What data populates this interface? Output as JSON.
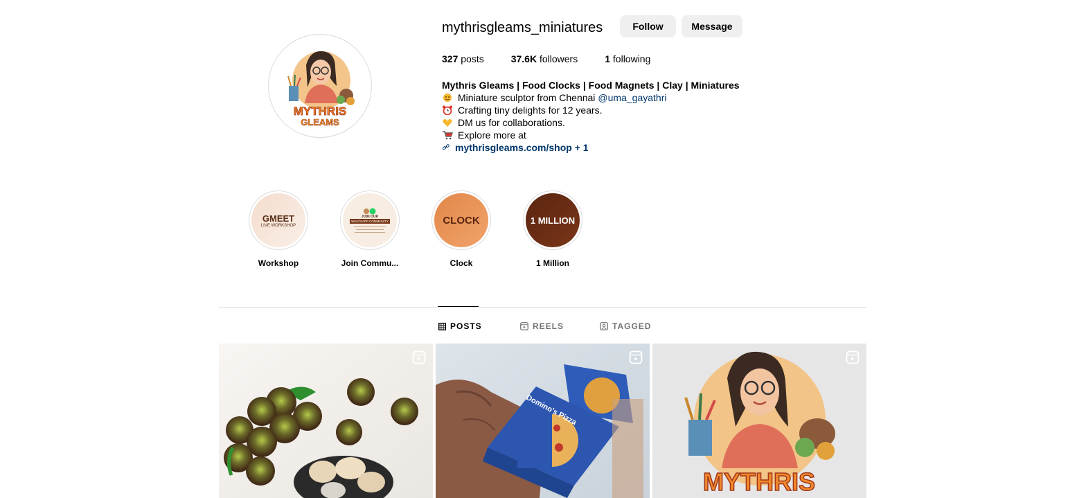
{
  "profile": {
    "username": "mythrisgleams_miniatures",
    "follow_label": "Follow",
    "message_label": "Message",
    "stats": {
      "posts_count": "327",
      "posts_label": "posts",
      "followers_count": "37.6K",
      "followers_label": "followers",
      "following_count": "1",
      "following_label": "following"
    },
    "avatar_text": "MYTHRIS GLEAMS"
  },
  "bio": {
    "name": "Mythris Gleams | Food Clocks | Food Magnets | Clay | Miniatures",
    "line1": "Miniature sculptor from Chennai",
    "mention": "@uma_gayathri",
    "line2": "Crafting tiny delights for 12 years.",
    "line3": "DM us for collaborations.",
    "line4": "Explore more at",
    "link": "mythrisgleams.com/shop + 1"
  },
  "highlights": [
    {
      "label": "Workshop",
      "cover_title": "GMEET",
      "cover_sub": "LIVE WORKSHOP"
    },
    {
      "label": "Join Commu...",
      "cover_title": "JOIN OUR",
      "cover_sub": "WHATSAPP COMMUNITY"
    },
    {
      "label": "Clock",
      "cover_title": "CLOCK"
    },
    {
      "label": "1 Million",
      "cover_title": "1 MILLION"
    }
  ],
  "tabs": [
    {
      "label": "POSTS",
      "icon": "grid-icon",
      "active": true
    },
    {
      "label": "REELS",
      "icon": "reels-icon",
      "active": false
    },
    {
      "label": "TAGGED",
      "icon": "tagged-icon",
      "active": false
    }
  ],
  "posts": [
    {
      "subject": "miniature fruits",
      "type": "reel"
    },
    {
      "subject": "miniature pizza box",
      "type": "reel",
      "box_text": "Domino's Pizza"
    },
    {
      "subject": "illustrated logo",
      "type": "reel",
      "logo_text": "MYTHRIS GLEAMS"
    }
  ],
  "colors": {
    "button_bg": "#efefef",
    "link": "#00376b",
    "divider": "#dbdbdb",
    "tab_inactive": "#737373"
  }
}
